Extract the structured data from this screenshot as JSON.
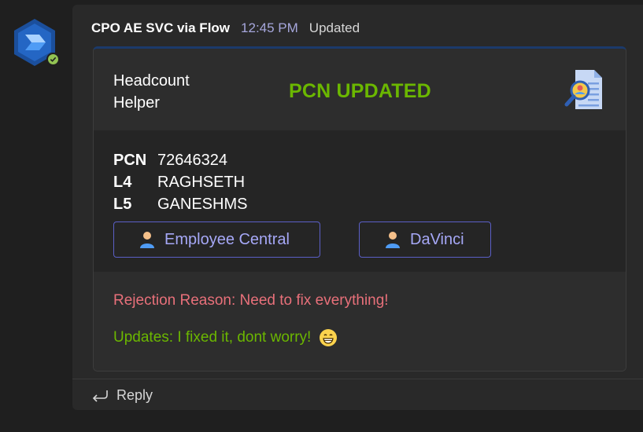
{
  "message": {
    "sender": "CPO AE SVC via Flow",
    "timestamp": "12:45 PM",
    "edited_label": "Updated",
    "avatar": {
      "icon": "power-automate-icon",
      "presence": "available"
    }
  },
  "card": {
    "title": "Headcount Helper",
    "status": "PCN UPDATED",
    "status_color": "#6bb700",
    "header_icon": "document-search-icon",
    "facts": [
      {
        "label": "PCN",
        "value": "72646324"
      },
      {
        "label": "L4",
        "value": "RAGHSETH"
      },
      {
        "label": "L5",
        "value": "GANESHMS"
      }
    ],
    "actions": [
      {
        "label": "Employee Central",
        "icon": "person-icon"
      },
      {
        "label": "DaVinci",
        "icon": "person-icon"
      }
    ],
    "rejection_text": "Rejection Reason: Need to fix everything!",
    "updates_text": "Updates: I fixed it, dont worry!",
    "updates_emoji": "grinning-face-icon"
  },
  "reply": {
    "label": "Reply",
    "icon": "reply-arrow-icon"
  },
  "colors": {
    "accent": "#5b5fc7",
    "link": "#a6a8f7",
    "rejection": "#e8707a",
    "updates": "#6bb700",
    "timestamp": "#a6a7dc"
  }
}
